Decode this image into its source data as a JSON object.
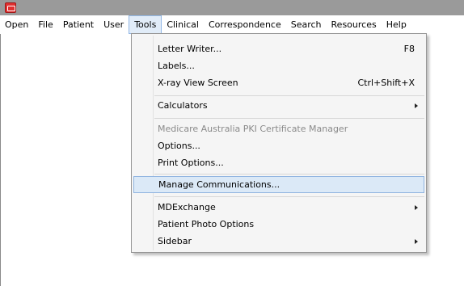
{
  "menubar": {
    "items": [
      "Open",
      "File",
      "Patient",
      "User",
      "Tools",
      "Clinical",
      "Correspondence",
      "Search",
      "Resources",
      "Help"
    ],
    "active": "Tools"
  },
  "tools_menu": {
    "letter_writer": {
      "label": "Letter Writer...",
      "shortcut": "F8"
    },
    "labels": {
      "label": "Labels..."
    },
    "xray_view": {
      "label": "X-ray View Screen",
      "shortcut": "Ctrl+Shift+X"
    },
    "calculators": {
      "label": "Calculators"
    },
    "medicare_pki": {
      "label": "Medicare Australia PKI Certificate Manager"
    },
    "options": {
      "label": "Options..."
    },
    "print_options": {
      "label": "Print Options..."
    },
    "manage_comms": {
      "label": "Manage Communications..."
    },
    "mdexchange": {
      "label": "MDExchange"
    },
    "patient_photo": {
      "label": "Patient Photo Options"
    },
    "sidebar": {
      "label": "Sidebar"
    }
  }
}
